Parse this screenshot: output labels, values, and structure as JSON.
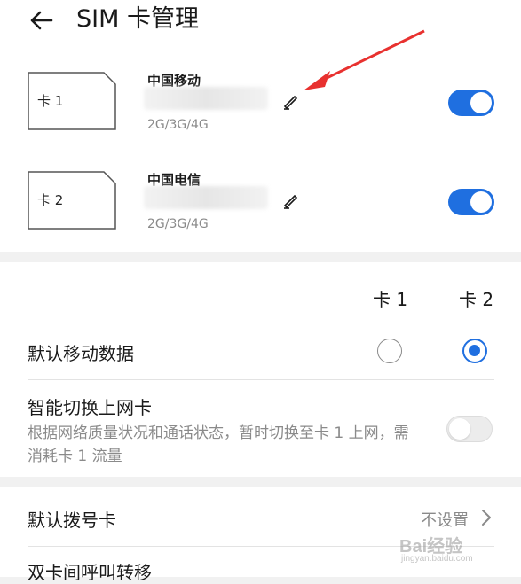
{
  "header": {
    "title": "SIM 卡管理"
  },
  "sims": [
    {
      "icon_label": "卡 1",
      "carrier": "中国移动",
      "network": "2G/3G/4G",
      "enabled": true
    },
    {
      "icon_label": "卡 2",
      "carrier": "中国电信",
      "network": "2G/3G/4G",
      "enabled": true
    }
  ],
  "default_data": {
    "col_card1": "卡 1",
    "col_card2": "卡 2",
    "label": "默认移动数据",
    "selected": "card2"
  },
  "smart_switch": {
    "title": "智能切换上网卡",
    "description": "根据网络质量状况和通话状态，暂时切换至卡 1 上网，需消耗卡 1 流量",
    "enabled": false
  },
  "default_dial": {
    "label": "默认拨号卡",
    "value": "不设置"
  },
  "call_forward": {
    "label": "双卡间呼叫转移"
  },
  "colors": {
    "accent": "#1f6fe0",
    "annotation": "#e8312f"
  },
  "icons": [
    "back-arrow-icon",
    "sim-card-icon",
    "edit-pencil-icon",
    "chevron-right-icon"
  ],
  "watermark": {
    "brand": "Bai经验",
    "url": "jingyan.baidu.com"
  }
}
